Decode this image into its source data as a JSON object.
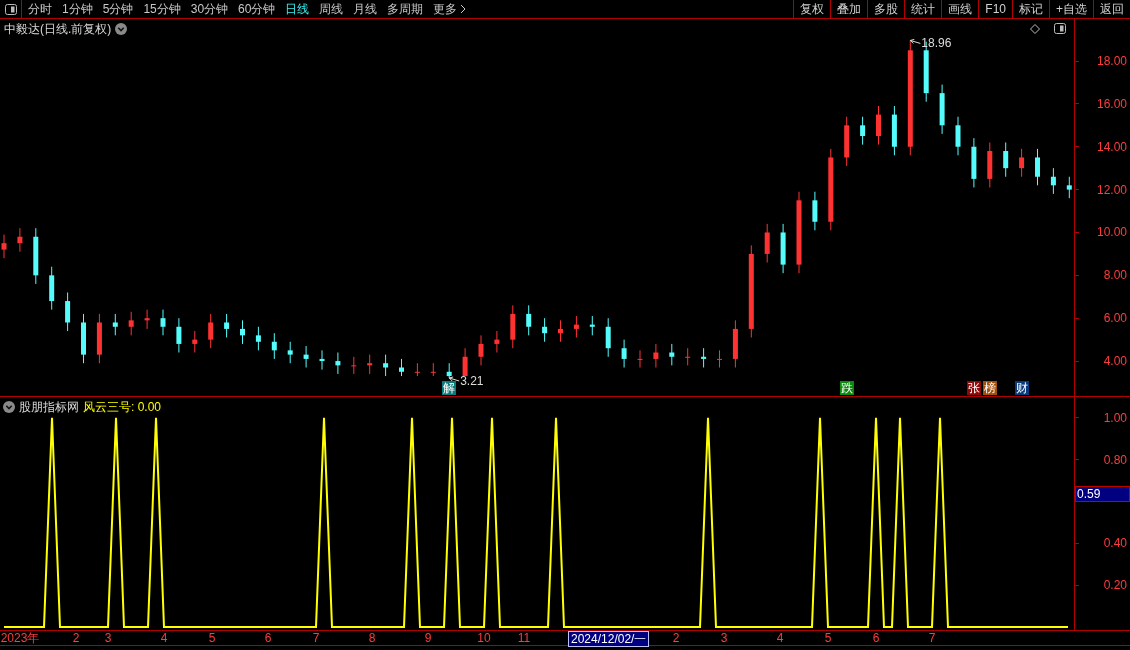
{
  "toolbar": {
    "periods": [
      {
        "label": "分时",
        "selected": false
      },
      {
        "label": "1分钟",
        "selected": false
      },
      {
        "label": "5分钟",
        "selected": false
      },
      {
        "label": "15分钟",
        "selected": false
      },
      {
        "label": "30分钟",
        "selected": false
      },
      {
        "label": "60分钟",
        "selected": false
      },
      {
        "label": "日线",
        "selected": true
      },
      {
        "label": "周线",
        "selected": false
      },
      {
        "label": "月线",
        "selected": false
      },
      {
        "label": "多周期",
        "selected": false
      },
      {
        "label": "更多",
        "selected": false
      }
    ],
    "buttons": [
      "复权",
      "叠加",
      "多股",
      "统计",
      "画线",
      "F10",
      "标记",
      "+自选",
      "返回"
    ]
  },
  "price_panel": {
    "title": "中毅达(日线.前复权)",
    "events": [
      {
        "text": "解",
        "color": "#0b7a7a"
      },
      {
        "text": "跌",
        "color": "#0a8a0a"
      },
      {
        "text": "张",
        "color": "#8b0a0a"
      },
      {
        "text": "榜",
        "color": "#a0500a"
      },
      {
        "text": "财",
        "color": "#0a3a7a"
      }
    ],
    "chart_data": {
      "type": "candlestick",
      "ylim": [
        2.37,
        19.96
      ],
      "yticks": [
        {
          "value": 4,
          "label": "4.00"
        },
        {
          "value": 6,
          "label": "6.00"
        },
        {
          "value": 8,
          "label": "8.00"
        },
        {
          "value": 10,
          "label": "10.00"
        },
        {
          "value": 12,
          "label": "12.00"
        },
        {
          "value": 14,
          "label": "14.00"
        },
        {
          "value": 16,
          "label": "16.00"
        },
        {
          "value": 18,
          "label": "18.00"
        }
      ],
      "categories": [
        null,
        null,
        null,
        null,
        null,
        null,
        null,
        null,
        null,
        null,
        null,
        null,
        null,
        null,
        null,
        null,
        null,
        null,
        null,
        null,
        null,
        null,
        null,
        null,
        null,
        null,
        null,
        null,
        null,
        null,
        null,
        null,
        null,
        null,
        null,
        null,
        null,
        null,
        null,
        null,
        null,
        null,
        null,
        null,
        null,
        null,
        null,
        null,
        null,
        null,
        null,
        null,
        null,
        null,
        null,
        null,
        null,
        null,
        null,
        null,
        null,
        null,
        null,
        null,
        null,
        null,
        null,
        null
      ],
      "ohlc": [
        [
          9.2,
          9.9,
          8.8,
          9.5
        ],
        [
          9.5,
          10.2,
          9.1,
          9.8
        ],
        [
          9.8,
          10.2,
          7.6,
          8.0
        ],
        [
          8.0,
          8.4,
          6.4,
          6.8
        ],
        [
          6.8,
          7.2,
          5.4,
          5.8
        ],
        [
          5.8,
          6.2,
          3.9,
          4.3
        ],
        [
          4.3,
          6.2,
          3.9,
          5.8
        ],
        [
          5.8,
          6.2,
          5.2,
          5.6
        ],
        [
          5.6,
          6.3,
          5.2,
          5.9
        ],
        [
          5.9,
          6.4,
          5.5,
          6.0
        ],
        [
          6.0,
          6.4,
          5.2,
          5.6
        ],
        [
          5.6,
          6.0,
          4.4,
          4.8
        ],
        [
          4.8,
          5.4,
          4.4,
          5.0
        ],
        [
          5.0,
          6.2,
          4.6,
          5.8
        ],
        [
          5.8,
          6.2,
          5.1,
          5.5
        ],
        [
          5.5,
          5.9,
          4.8,
          5.2
        ],
        [
          5.2,
          5.6,
          4.5,
          4.9
        ],
        [
          4.9,
          5.3,
          4.1,
          4.5
        ],
        [
          4.5,
          4.9,
          3.9,
          4.3
        ],
        [
          4.3,
          4.7,
          3.7,
          4.1
        ],
        [
          4.1,
          4.5,
          3.6,
          4.0
        ],
        [
          4.0,
          4.4,
          3.4,
          3.8
        ],
        [
          3.8,
          4.2,
          3.4,
          3.8
        ],
        [
          3.8,
          4.3,
          3.4,
          3.9
        ],
        [
          3.9,
          4.3,
          3.3,
          3.7
        ],
        [
          3.7,
          4.1,
          3.3,
          3.5
        ],
        [
          3.5,
          3.9,
          3.3,
          3.5
        ],
        [
          3.5,
          3.9,
          3.3,
          3.5
        ],
        [
          3.5,
          3.9,
          3.21,
          3.3
        ],
        [
          3.3,
          4.6,
          3.3,
          4.2
        ],
        [
          4.2,
          5.2,
          3.8,
          4.8
        ],
        [
          4.8,
          5.4,
          4.4,
          5.0
        ],
        [
          5.0,
          6.6,
          4.6,
          6.2
        ],
        [
          6.2,
          6.6,
          5.2,
          5.6
        ],
        [
          5.6,
          6.0,
          4.9,
          5.3
        ],
        [
          5.3,
          5.9,
          4.9,
          5.5
        ],
        [
          5.5,
          6.1,
          5.1,
          5.7
        ],
        [
          5.7,
          6.1,
          5.2,
          5.6
        ],
        [
          5.6,
          6.0,
          4.2,
          4.6
        ],
        [
          4.6,
          5.0,
          3.7,
          4.1
        ],
        [
          4.1,
          4.5,
          3.7,
          4.1
        ],
        [
          4.1,
          4.8,
          3.7,
          4.4
        ],
        [
          4.4,
          4.8,
          3.8,
          4.2
        ],
        [
          4.2,
          4.6,
          3.8,
          4.2
        ],
        [
          4.2,
          4.6,
          3.7,
          4.1
        ],
        [
          4.1,
          4.5,
          3.7,
          4.1
        ],
        [
          4.1,
          5.9,
          3.7,
          5.5
        ],
        [
          5.5,
          9.4,
          5.1,
          9.0
        ],
        [
          9.0,
          10.4,
          8.6,
          10.0
        ],
        [
          10.0,
          10.4,
          8.1,
          8.5
        ],
        [
          8.5,
          11.9,
          8.1,
          11.5
        ],
        [
          11.5,
          11.9,
          10.1,
          10.5
        ],
        [
          10.5,
          13.9,
          10.1,
          13.5
        ],
        [
          13.5,
          15.4,
          13.1,
          15.0
        ],
        [
          15.0,
          15.4,
          14.1,
          14.5
        ],
        [
          14.5,
          15.9,
          14.1,
          15.5
        ],
        [
          15.5,
          15.9,
          13.6,
          14.0
        ],
        [
          14.0,
          18.96,
          13.6,
          18.5
        ],
        [
          18.5,
          18.9,
          16.1,
          16.5
        ],
        [
          16.5,
          16.9,
          14.6,
          15.0
        ],
        [
          15.0,
          15.4,
          13.6,
          14.0
        ],
        [
          14.0,
          14.4,
          12.1,
          12.5
        ],
        [
          12.5,
          14.2,
          12.1,
          13.8
        ],
        [
          13.8,
          14.2,
          12.6,
          13.0
        ],
        [
          13.0,
          13.9,
          12.6,
          13.5
        ],
        [
          13.5,
          13.9,
          12.2,
          12.6
        ],
        [
          12.6,
          13.0,
          11.8,
          12.2
        ],
        [
          12.2,
          12.6,
          11.6,
          12.0
        ]
      ],
      "annotations": [
        {
          "text": "18.96"
        },
        {
          "text": "3.21"
        }
      ]
    }
  },
  "indicator_panel": {
    "source": "股朋指标网",
    "title": "风云三号: 0.00",
    "cursor_value": "0.59",
    "cursor_date": "2024/12/02/一",
    "chart_data": {
      "type": "line",
      "ylim": [
        -0.0143,
        1.1
      ],
      "yticks": [
        {
          "value": 0.2,
          "label": "0.20"
        },
        {
          "value": 0.4,
          "label": "0.40"
        },
        {
          "value": 0.8,
          "label": "0.80"
        },
        {
          "value": 1.0,
          "label": "1.00"
        }
      ],
      "categories": [
        null,
        null,
        "2023年",
        null,
        null,
        null,
        null,
        null,
        null,
        "2",
        null,
        null,
        null,
        "3",
        null,
        null,
        null,
        null,
        null,
        null,
        "4",
        null,
        null,
        null,
        null,
        null,
        "5",
        null,
        null,
        null,
        null,
        null,
        null,
        "6",
        null,
        null,
        null,
        null,
        null,
        "7",
        null,
        null,
        null,
        null,
        null,
        null,
        "8",
        null,
        null,
        null,
        null,
        null,
        null,
        "9",
        null,
        null,
        null,
        null,
        null,
        null,
        "10",
        null,
        null,
        null,
        null,
        "11",
        null,
        null,
        null,
        null,
        null,
        null,
        null,
        null,
        null,
        null,
        null,
        null,
        null,
        null,
        null,
        null,
        null,
        null,
        "2",
        null,
        null,
        null,
        null,
        null,
        "3",
        null,
        null,
        null,
        null,
        null,
        null,
        "4",
        null,
        null,
        null,
        null,
        null,
        "5",
        null,
        null,
        null,
        null,
        null,
        "6",
        null,
        null,
        null,
        null,
        null,
        null,
        "7",
        null,
        null,
        null,
        null,
        null,
        null,
        null,
        null,
        null,
        null,
        null,
        null,
        null,
        null,
        null,
        null,
        null
      ],
      "series": [
        {
          "color": "#ffff00",
          "values": [
            0,
            0,
            0,
            0,
            0,
            0,
            1,
            0,
            0,
            0,
            0,
            0,
            0,
            0,
            1,
            0,
            0,
            0,
            0,
            1,
            0,
            0,
            0,
            0,
            0,
            0,
            0,
            0,
            0,
            0,
            0,
            0,
            0,
            0,
            0,
            0,
            0,
            0,
            0,
            0,
            1,
            0,
            0,
            0,
            0,
            0,
            0,
            0,
            0,
            0,
            0,
            1,
            0,
            0,
            0,
            0,
            1,
            0,
            0,
            0,
            0,
            1,
            0,
            0,
            0,
            0,
            0,
            0,
            0,
            1,
            0,
            0,
            0,
            0,
            0,
            0,
            0,
            0,
            0,
            0,
            0,
            0,
            0,
            0,
            0,
            0,
            0,
            0,
            1,
            0,
            0,
            0,
            0,
            0,
            0,
            0,
            0,
            0,
            0,
            0,
            0,
            0,
            1,
            0,
            0,
            0,
            0,
            0,
            0,
            1,
            0,
            0,
            1,
            0,
            0,
            0,
            0,
            1,
            0,
            0,
            0,
            0,
            0,
            0,
            0,
            0,
            0,
            0,
            0,
            0,
            0,
            0,
            0,
            0
          ]
        }
      ]
    }
  }
}
